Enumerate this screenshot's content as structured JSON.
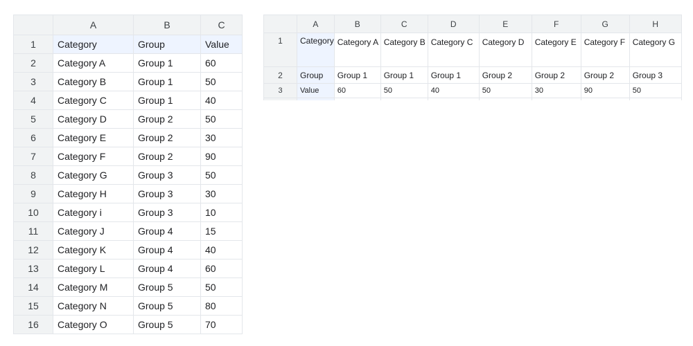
{
  "left_sheet": {
    "col_headers": [
      "A",
      "B",
      "C"
    ],
    "rows": [
      {
        "num": "1",
        "a": "Category",
        "b": "Group",
        "c": "Value"
      },
      {
        "num": "2",
        "a": "Category A",
        "b": "Group 1",
        "c": "60"
      },
      {
        "num": "3",
        "a": "Category B",
        "b": "Group 1",
        "c": "50"
      },
      {
        "num": "4",
        "a": "Category C",
        "b": "Group 1",
        "c": "40"
      },
      {
        "num": "5",
        "a": "Category D",
        "b": "Group 2",
        "c": "50"
      },
      {
        "num": "6",
        "a": "Category E",
        "b": "Group 2",
        "c": "30"
      },
      {
        "num": "7",
        "a": "Category F",
        "b": "Group 2",
        "c": "90"
      },
      {
        "num": "8",
        "a": "Category G",
        "b": "Group 3",
        "c": "50"
      },
      {
        "num": "9",
        "a": "Category H",
        "b": "Group 3",
        "c": "30"
      },
      {
        "num": "10",
        "a": "Category i",
        "b": "Group 3",
        "c": "10"
      },
      {
        "num": "11",
        "a": "Category J",
        "b": "Group 4",
        "c": "15"
      },
      {
        "num": "12",
        "a": "Category K",
        "b": "Group 4",
        "c": "40"
      },
      {
        "num": "13",
        "a": "Category L",
        "b": "Group 4",
        "c": "60"
      },
      {
        "num": "14",
        "a": "Category M",
        "b": "Group 5",
        "c": "50"
      },
      {
        "num": "15",
        "a": "Category N",
        "b": "Group 5",
        "c": "80"
      },
      {
        "num": "16",
        "a": "Category O",
        "b": "Group 5",
        "c": "70"
      }
    ]
  },
  "right_sheet": {
    "col_headers": [
      "A",
      "B",
      "C",
      "D",
      "E",
      "F",
      "G",
      "H"
    ],
    "rows": [
      {
        "num": "1",
        "cells": [
          "Category",
          "Category A",
          "Category B",
          "Category C",
          "Category D",
          "Category E",
          "Category F",
          "Category G"
        ]
      },
      {
        "num": "2",
        "cells": [
          "Group",
          "Group 1",
          "Group 1",
          "Group 1",
          "Group 2",
          "Group 2",
          "Group 2",
          "Group 3"
        ]
      },
      {
        "num": "3",
        "cells": [
          "Value",
          "60",
          "50",
          "40",
          "50",
          "30",
          "90",
          "50"
        ]
      }
    ]
  }
}
